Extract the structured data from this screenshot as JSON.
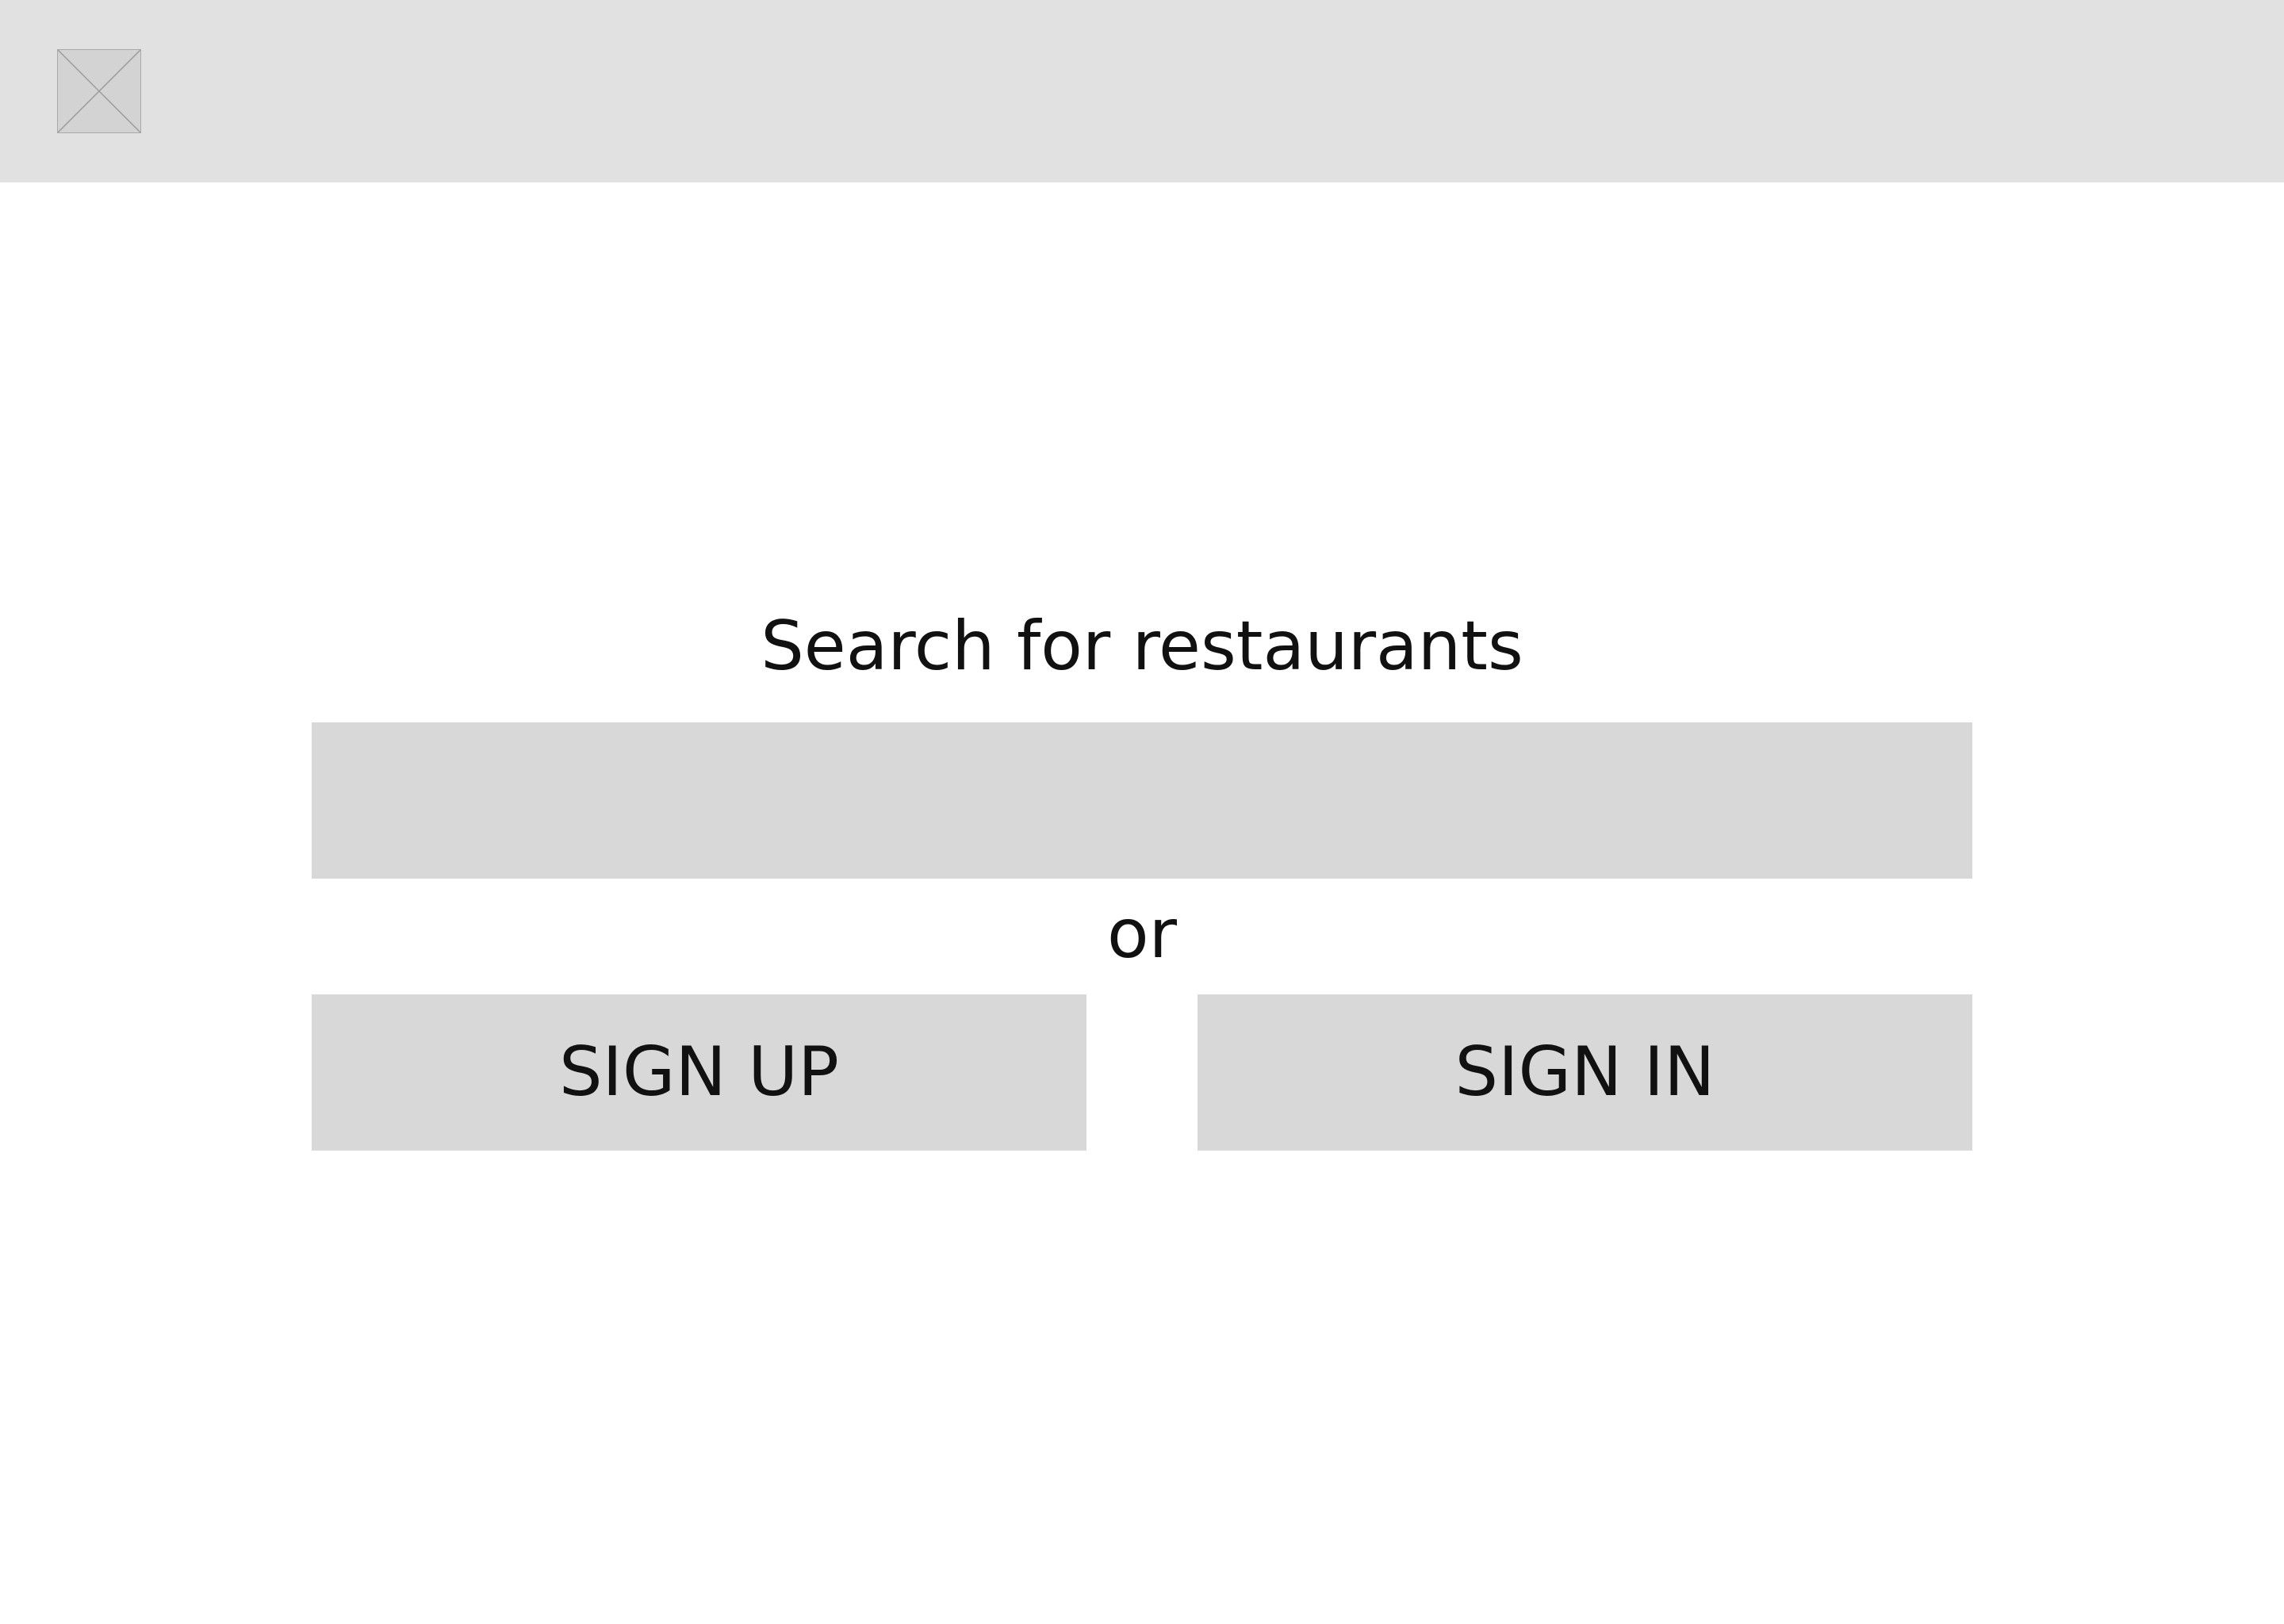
{
  "header": {
    "logo_icon": "image-placeholder-icon"
  },
  "main": {
    "title": "Search for restaurants",
    "search_value": "",
    "separator": "or",
    "signup_label": "SIGN UP",
    "signin_label": "SIGN IN"
  },
  "colors": {
    "header_bg": "#e1e1e1",
    "control_bg": "#d8d8d8",
    "text": "#111111"
  }
}
